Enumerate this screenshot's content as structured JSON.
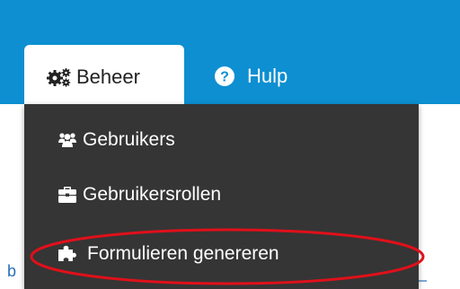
{
  "nav": {
    "tabs": [
      {
        "label": "Beheer",
        "icon": "gears-icon",
        "active": true
      },
      {
        "label": "Hulp",
        "icon": "question-circle-icon",
        "active": false
      }
    ]
  },
  "dropdown": {
    "items": [
      {
        "label": "Gebruikers",
        "icon": "users-icon"
      },
      {
        "label": "Gebruikersrollen",
        "icon": "briefcase-icon"
      },
      {
        "label": "Formulieren genereren",
        "icon": "puzzle-icon",
        "highlighted": true
      }
    ]
  },
  "background": {
    "partial_link_text": "b"
  },
  "colors": {
    "topbar": "#0d8fd1",
    "dropdown_bg": "#353535",
    "highlight": "#e0101a",
    "link": "#2a6ebb"
  }
}
